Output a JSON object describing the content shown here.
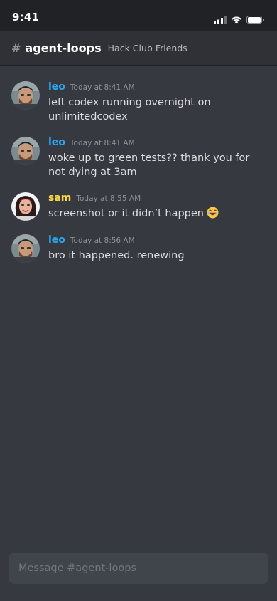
{
  "status_bar": {
    "time": "9:41",
    "icons": [
      "cellular-signal-icon",
      "wifi-icon",
      "battery-icon"
    ]
  },
  "header": {
    "channel_prefix": "#",
    "channel_name": "agent-loops",
    "server_name": "Hack Club Friends"
  },
  "colors": {
    "background": "#36393f",
    "header_bg": "#2f3136",
    "status_bar_bg": "#202225",
    "leo_name": "#2aa7f2",
    "sam_name": "#f6d845",
    "message_text": "#dcddde",
    "timestamp": "#8e9297",
    "composer_bg": "#40444b"
  },
  "messages": [
    {
      "author": "leo",
      "timestamp": "Today at 8:41 AM",
      "text": "left codex running overnight on unlimitedcodex"
    },
    {
      "author": "leo",
      "timestamp": "Today at 8:41 AM",
      "text": "woke up to green tests?? thank you for not dying at 3am"
    },
    {
      "author": "sam",
      "timestamp": "Today at 8:55 AM",
      "text": "screenshot or it didn’t happen",
      "emoji": "laughing-face-emoji"
    },
    {
      "author": "leo",
      "timestamp": "Today at 8:56 AM",
      "text": "bro it happened. renewing"
    }
  ],
  "composer": {
    "placeholder": "Message #agent-loops",
    "value": ""
  }
}
